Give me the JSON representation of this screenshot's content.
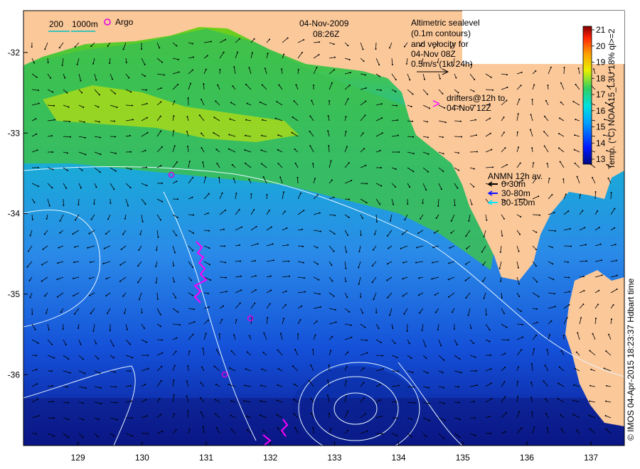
{
  "map": {
    "date": "04-Nov-2009",
    "time": "08:26Z",
    "scale_bar": {
      "labels": [
        "200",
        "1000m"
      ]
    },
    "argo_label": "Argo",
    "altimetry": {
      "lines": [
        "Altimetric sealevel",
        "(0.1m contours)",
        "and velocity for",
        "04-Nov 08Z",
        "0.5m/s (1kt 24h)"
      ]
    },
    "drifters": {
      "marker": ">",
      "lines": [
        "drifters@12h to",
        "04-Nov 12Z"
      ]
    },
    "anmn": {
      "title": "ANMN 12h av.",
      "items": [
        {
          "label": "0-30m",
          "color": "#000000"
        },
        {
          "label": "30-80m",
          "color": "#1010ff"
        },
        {
          "label": "80-150m",
          "color": "#00e5ff"
        }
      ]
    },
    "colorbar": {
      "title": "Temp. (°C) NOAA15_L3U 18% ql>=2",
      "ticks": [
        "21",
        "20",
        "19",
        "18",
        "17",
        "16",
        "15",
        "14",
        "13"
      ]
    },
    "credit": "© IMOS 04-Apr-2015 18:23:37 Hdbart time",
    "x_ticks": [
      "129",
      "130",
      "131",
      "132",
      "133",
      "134",
      "135",
      "136",
      "137"
    ],
    "y_ticks": [
      "-32",
      "-33",
      "-34",
      "-35",
      "-36"
    ],
    "colors": {
      "land": "#fbc89a",
      "argo": "#e000e0",
      "drifter": "#ff00ff",
      "contour": "#d8f0ff"
    }
  }
}
